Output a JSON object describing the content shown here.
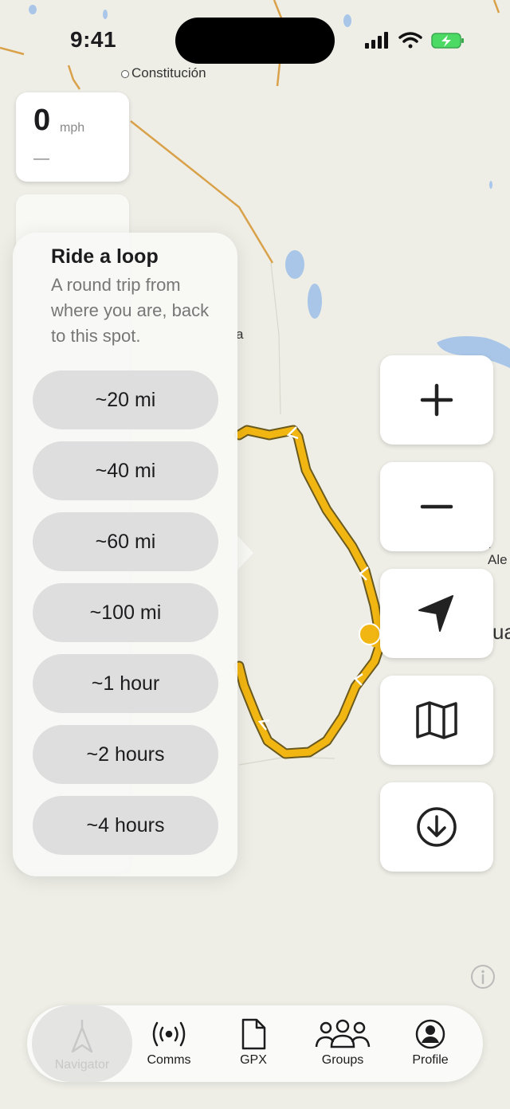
{
  "status_bar": {
    "time": "9:41"
  },
  "map": {
    "place_labels": [
      "Constitución",
      "a",
      ". Ale",
      "ua"
    ],
    "route_color": "#f2b612",
    "user_location_color": "#f2b612"
  },
  "speed_card": {
    "value": "0",
    "unit": "mph",
    "sub": "—"
  },
  "loop_popover": {
    "title": "Ride a loop",
    "subtitle": "A round trip from where you are, back to this spot.",
    "options": [
      "~20 mi",
      "~40 mi",
      "~60 mi",
      "~100 mi",
      "~1 hour",
      "~2 hours",
      "~4 hours"
    ]
  },
  "map_controls": {
    "icons": [
      "plus-icon",
      "minus-icon",
      "location-arrow-icon",
      "map-icon",
      "download-icon"
    ]
  },
  "tab_bar": {
    "tabs": [
      {
        "label": "Navigator",
        "icon": "navigator-icon",
        "active": true
      },
      {
        "label": "Comms",
        "icon": "broadcast-icon",
        "active": false
      },
      {
        "label": "GPX",
        "icon": "file-icon",
        "active": false
      },
      {
        "label": "Groups",
        "icon": "groups-icon",
        "active": false
      },
      {
        "label": "Profile",
        "icon": "profile-icon",
        "active": false
      }
    ]
  }
}
